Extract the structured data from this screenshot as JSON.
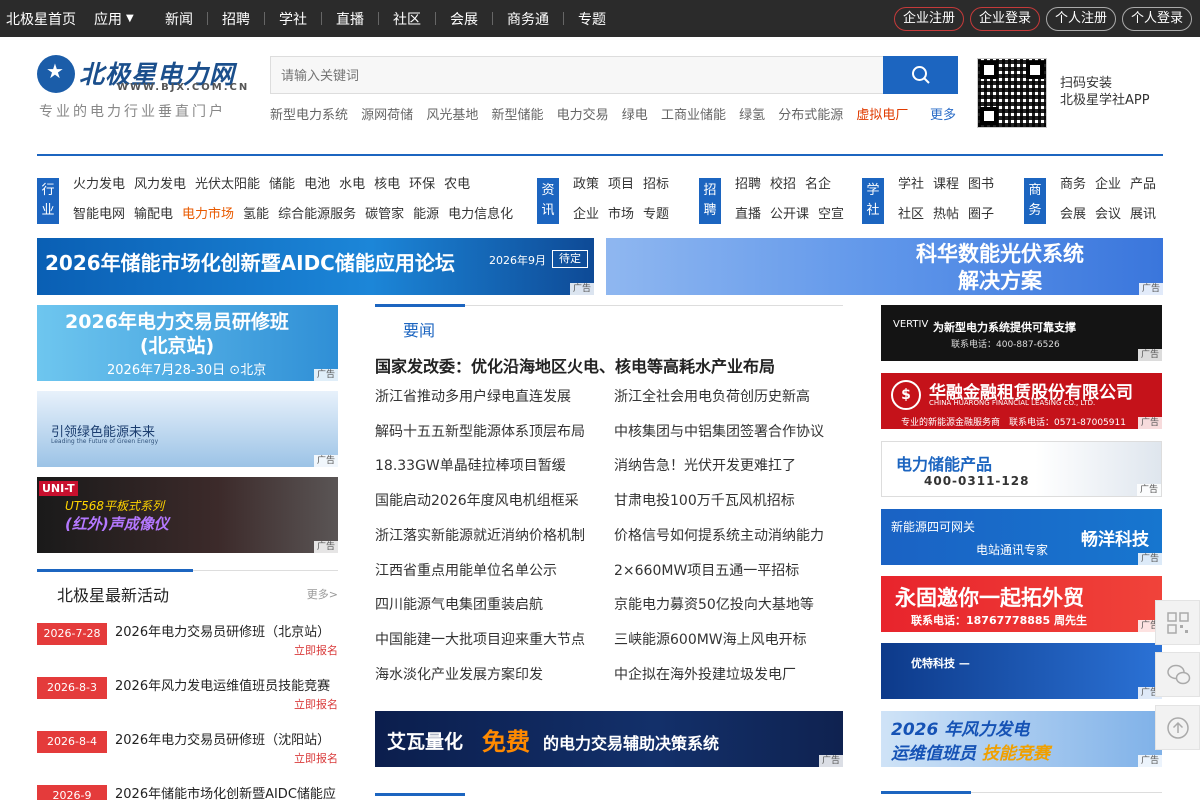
{
  "topbar": {
    "home": "北极星首页",
    "app": "应用",
    "links": [
      "新闻",
      "招聘",
      "学社",
      "直播",
      "社区",
      "会展",
      "商务通",
      "专题"
    ],
    "auth": [
      "企业注册",
      "企业登录",
      "个人注册",
      "个人登录"
    ]
  },
  "logo": {
    "name": "北极星电力网",
    "url": "WWW.BJX.COM.CN",
    "slogan": "专业的电力行业垂直门户"
  },
  "search": {
    "placeholder": "请输入关键词",
    "hotwords": [
      "新型电力系统",
      "源网荷储",
      "风光基地",
      "新型储能",
      "电力交易",
      "绿电",
      "工商业储能",
      "绿氢",
      "分布式能源"
    ],
    "hot_red": "虚拟电厂",
    "more": "更多"
  },
  "app_download": {
    "line1": "扫码安装",
    "line2": "北极星学社APP"
  },
  "categories": [
    {
      "tag": "行业",
      "rows": [
        [
          "火力发电",
          "风力发电",
          "光伏太阳能",
          "储能",
          "电池",
          "水电",
          "核电",
          "环保",
          "农电"
        ],
        [
          "智能电网",
          "输配电",
          "电力市场",
          "氢能",
          "综合能源服务",
          "碳管家",
          "能源",
          "电力信息化"
        ]
      ]
    },
    {
      "tag": "资讯",
      "rows": [
        [
          "政策",
          "项目",
          "招标"
        ],
        [
          "企业",
          "市场",
          "专题"
        ]
      ]
    },
    {
      "tag": "招聘",
      "rows": [
        [
          "招聘",
          "校招",
          "名企"
        ],
        [
          "直播",
          "公开课",
          "空宣"
        ]
      ]
    },
    {
      "tag": "学社",
      "rows": [
        [
          "学社",
          "课程",
          "图书"
        ],
        [
          "社区",
          "热帖",
          "圈子"
        ]
      ]
    },
    {
      "tag": "商务",
      "rows": [
        [
          "商务",
          "企业",
          "产品"
        ],
        [
          "会展",
          "会议",
          "展讯"
        ]
      ]
    }
  ],
  "ad_label": "广告",
  "banners": {
    "b1": {
      "title": "2026年储能市场化创新暨AIDC储能应用论坛",
      "date": "2026年9月",
      "status": "待定"
    },
    "b2": {
      "line1": "科华数能光伏系统",
      "line2": "解决方案"
    }
  },
  "left_ads": {
    "lb1": {
      "line1": "2026年电力交易员研修班",
      "line2": "(北京站)",
      "date": "2026年7月28-30日",
      "place": "北京"
    },
    "lb2": {
      "title": "引领绿色能源未来",
      "sub": "Leading the Future of Green Energy"
    },
    "lb3": {
      "brand": "UNI-T",
      "line1": "UT568平板式系列",
      "line2": "(红外)声成像仪"
    }
  },
  "activities": {
    "title": "北极星最新活动",
    "more": "更多>",
    "register": "立即报名",
    "items": [
      {
        "date": "2026-7-28",
        "title": "2026年电力交易员研修班（北京站）"
      },
      {
        "date": "2026-8-3",
        "title": "2026年风力发电运维值班员技能竞赛"
      },
      {
        "date": "2026-8-4",
        "title": "2026年电力交易员研修班（沈阳站）"
      },
      {
        "date": "2026-9",
        "title": "2026年储能市场化创新暨AIDC储能应"
      }
    ]
  },
  "news": {
    "tab": "要闻",
    "headline": "国家发改委：优化沿海地区火电、核电等高耗水产业布局",
    "left": [
      "浙江省推动多用户绿电直连发展",
      "解码十五五新型能源体系顶层布局",
      "18.33GW单晶硅拉棒项目暂缓",
      "国能启动2026年度风电机组框采",
      "浙江落实新能源就近消纳价格机制",
      "江西省重点用能单位名单公示",
      "四川能源气电集团重装启航",
      "中国能建一大批项目迎来重大节点",
      "海水淡化产业发展方案印发"
    ],
    "right": [
      "浙江全社会用电负荷创历史新高",
      "中核集团与中铝集团签署合作协议",
      "消纳告急！光伏开发更难扛了",
      "甘肃电投100万千瓦风机招标",
      "价格信号如何提系统主动消纳能力",
      "2×660MW项目五通一平招标",
      "京能电力募资50亿投向大基地等",
      "三峡能源600MW海上风电开标",
      "中企拟在海外投建垃圾发电厂"
    ]
  },
  "mid_ad": {
    "brand": "艾瓦量化",
    "free": "免费",
    "rest": "的电力交易辅助决策系统"
  },
  "right_ads": {
    "rb1": {
      "logo": "VERTIV",
      "title": "为新型电力系统提供可靠支撑",
      "phone": "联系电话：400-887-6526"
    },
    "rb2": {
      "title": "华融金融租赁股份有限公司",
      "en": "CHINA HUARONG FINANCIAL LEASING CO., LTD.",
      "sub": "专业的新能源金融服务商　联系电话：0571-87005911"
    },
    "rb3": {
      "title": "电力储能产品",
      "phone": "400-0311-128"
    },
    "rb4": {
      "title": "新能源四可网关",
      "sub": "电站通讯专家",
      "brand": "畅洋科技"
    },
    "rb5": {
      "title": "永固邀你一起拓外贸",
      "sub": "联系电话：18767778885 周先生"
    },
    "rb6": {
      "title": "优特科技 —"
    },
    "rb7": {
      "line1": "2026 年风力发电",
      "line2a": "运维值班员 ",
      "line2b": "技能竞赛"
    }
  },
  "colors": {
    "accent": "#1c65c0",
    "topbar": "#2b2b2b",
    "red": "#e43b3b"
  }
}
